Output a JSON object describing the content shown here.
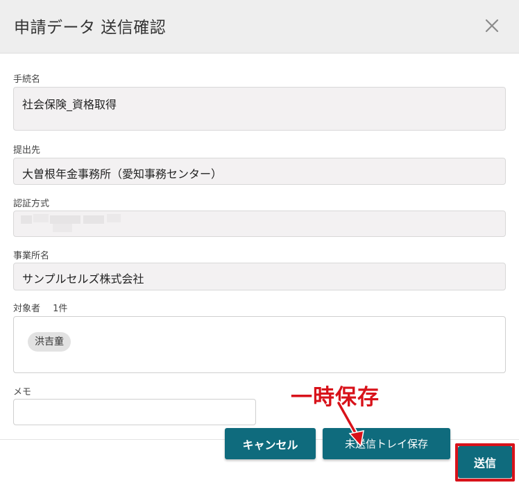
{
  "dialog": {
    "title": "申請データ 送信確認"
  },
  "fields": {
    "procedure": {
      "label": "手続名",
      "value": "社会保険_資格取得"
    },
    "destination": {
      "label": "提出先",
      "value": "大曽根年金事務所（愛知事務センター）"
    },
    "auth_method": {
      "label": "認証方式",
      "value": ""
    },
    "office": {
      "label": "事業所名",
      "value": "サンプルセルズ株式会社"
    },
    "targets": {
      "label": "対象者",
      "count": "1件",
      "chips": [
        "洪吉童"
      ]
    },
    "memo": {
      "label": "メモ",
      "value": ""
    }
  },
  "buttons": {
    "cancel": "キャンセル",
    "save_to_tray": "未送信トレイ保存",
    "send": "送信"
  },
  "annotation": {
    "text": "一時保存",
    "color": "#d8121a"
  },
  "colors": {
    "accent": "#0f6b7d",
    "highlight": "#d8121a"
  }
}
